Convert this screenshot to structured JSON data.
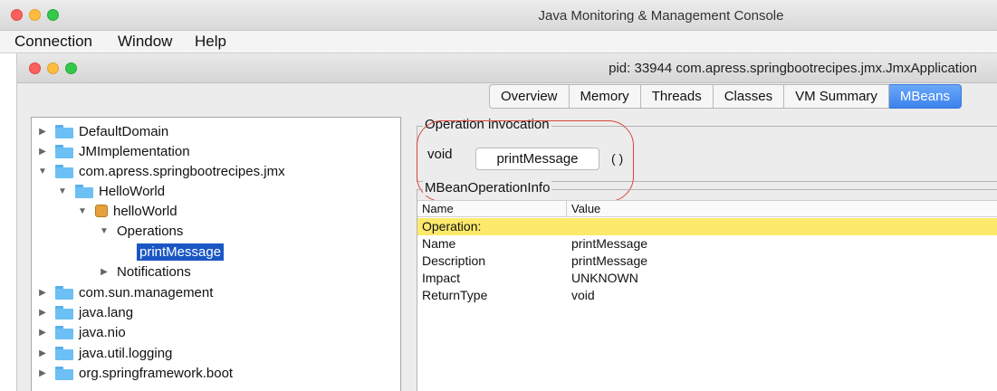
{
  "app": {
    "title": "Java Monitoring & Management Console",
    "menu": [
      "Connection",
      "Window",
      "Help"
    ]
  },
  "connection_window": {
    "title": "pid: 33944 com.apress.springbootrecipes.jmx.JmxApplication",
    "tabs": [
      "Overview",
      "Memory",
      "Threads",
      "Classes",
      "VM Summary",
      "MBeans"
    ],
    "active_tab": "MBeans"
  },
  "tree": {
    "items": [
      {
        "label": "DefaultDomain",
        "expanded": false
      },
      {
        "label": "JMImplementation",
        "expanded": false
      },
      {
        "label": "com.apress.springbootrecipes.jmx",
        "expanded": true
      },
      {
        "label": "HelloWorld",
        "expanded": true
      },
      {
        "label": "helloWorld",
        "expanded": true
      },
      {
        "label": "Operations",
        "expanded": true
      },
      {
        "label": "printMessage",
        "selected": true
      },
      {
        "label": "Notifications",
        "expanded": false
      },
      {
        "label": "com.sun.management",
        "expanded": false
      },
      {
        "label": "java.lang",
        "expanded": false
      },
      {
        "label": "java.nio",
        "expanded": false
      },
      {
        "label": "java.util.logging",
        "expanded": false
      },
      {
        "label": "org.springframework.boot",
        "expanded": false
      }
    ]
  },
  "operation_invocation": {
    "legend": "Operation invocation",
    "return_type": "void",
    "button_label": "printMessage",
    "params": "( )"
  },
  "mbean_operation_info": {
    "legend": "MBeanOperationInfo",
    "columns": [
      "Name",
      "Value"
    ],
    "section_row": "Operation:",
    "rows": [
      [
        "Name",
        "printMessage"
      ],
      [
        "Description",
        "printMessage"
      ],
      [
        "Impact",
        "UNKNOWN"
      ],
      [
        "ReturnType",
        "void"
      ]
    ]
  },
  "colors": {
    "accent_tab": "#3b82ee",
    "selection": "#1a56c4",
    "highlight_row": "#fde96b",
    "annotation_circle": "#d9453a"
  }
}
